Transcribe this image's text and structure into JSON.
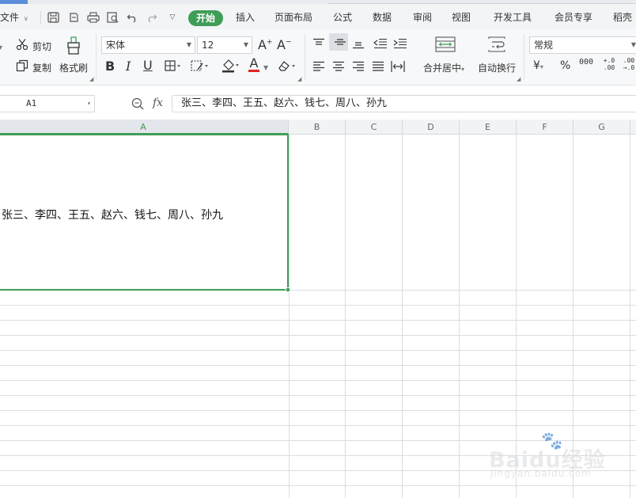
{
  "menu": {
    "file": "文件",
    "tabs": [
      "开始",
      "插入",
      "页面布局",
      "公式",
      "数据",
      "审阅",
      "视图",
      "开发工具",
      "会员专享",
      "稻壳"
    ]
  },
  "ribbon": {
    "cut": "剪切",
    "copy": "复制",
    "format_painter": "格式刷",
    "font_name": "宋体",
    "font_size": "12",
    "merge_center": "合并居中",
    "wrap_text": "自动换行",
    "number_format": "常规",
    "currency_symbol": "¥",
    "percent_symbol": "%",
    "thousands_symbol": "000",
    "increase_decimal": "+.0 .00",
    "decrease_decimal": ".00 →.0"
  },
  "formula_bar": {
    "name_box": "A1",
    "fx": "fx",
    "content": "张三、李四、王五、赵六、钱七、周八、孙九"
  },
  "grid": {
    "columns": [
      "A",
      "B",
      "C",
      "D",
      "E",
      "F",
      "G"
    ],
    "active_column": "A",
    "cells": {
      "A1": "张三、李四、王五、赵六、钱七、周八、孙九"
    }
  },
  "watermark": {
    "main": "Baidu经验",
    "sub": "jingyan.baidu.com"
  },
  "colors": {
    "accent": "#3f9d58",
    "menubar_bg": "#f3f4f6",
    "ribbon_bg": "#f7f8fa",
    "font_color_underline": "#e0241f"
  }
}
